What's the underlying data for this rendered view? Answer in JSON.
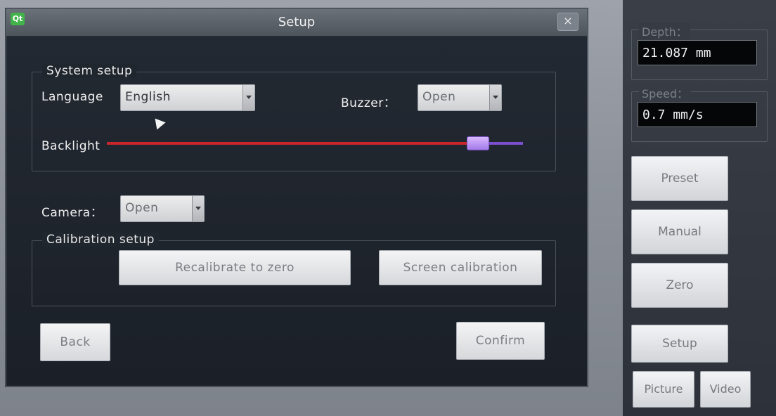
{
  "dialog": {
    "title": "Setup",
    "logo": "Qt",
    "close_glyph": "×",
    "system_setup": {
      "title": "System setup",
      "language_label": "Language",
      "language_value": "English",
      "buzzer_label": "Buzzer：",
      "buzzer_value": "Open",
      "backlight_label": "Backlight",
      "backlight_level": 0.89
    },
    "camera_label": "Camera：",
    "camera_value": "Open",
    "calibration": {
      "title": "Calibration setup",
      "recalibrate_label": "Recalibrate to zero",
      "screen_label": "Screen calibration"
    },
    "back_label": "Back",
    "confirm_label": "Confirm"
  },
  "side": {
    "depth_label": "Depth：",
    "depth_value": "21.087 mm",
    "speed_label": "Speed：",
    "speed_value": "0.7 mm/s",
    "preset_label": "Preset",
    "manual_label": "Manual",
    "zero_label": "Zero",
    "setup_label": "Setup",
    "picture_label": "Picture",
    "video_label": "Video"
  },
  "colors": {
    "slider_fill": "#c8262c",
    "slider_rest": "#7d4fd0",
    "logo": "#41b34a"
  }
}
